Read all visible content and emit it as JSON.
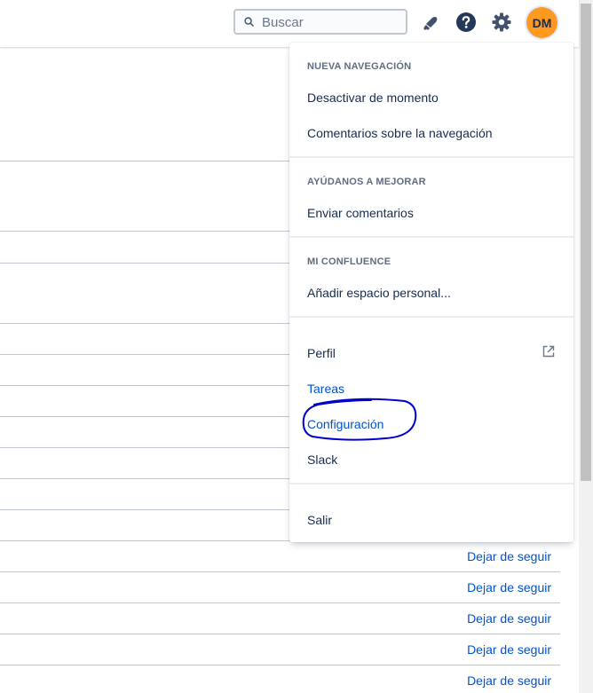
{
  "topbar": {
    "search_placeholder": "Buscar",
    "icons": [
      "search-icon",
      "notifications-icon",
      "help-icon",
      "settings-icon"
    ],
    "avatar_initials": "DM"
  },
  "list": {
    "unfollow_label": "Dejar de seguir"
  },
  "menu": {
    "sections": [
      {
        "heading": "NUEVA NAVEGACIÓN",
        "items": [
          "Desactivar de momento",
          "Comentarios sobre la navegación"
        ]
      },
      {
        "heading": "AYÚDANOS A MEJORAR",
        "items": [
          "Enviar comentarios"
        ]
      },
      {
        "heading": "MI CONFLUENCE",
        "items": [
          "Añadir espacio personal..."
        ]
      },
      {
        "heading": "",
        "items": [
          "Perfil",
          "Tareas",
          "Configuración",
          "Slack"
        ]
      },
      {
        "heading": "",
        "items": [
          "Salir"
        ]
      }
    ]
  },
  "colors": {
    "link": "#0052cc",
    "text": "#172b4d",
    "heading": "#5e6c84",
    "avatar_bg": "#ff991f",
    "annotation": "#0000cc"
  }
}
